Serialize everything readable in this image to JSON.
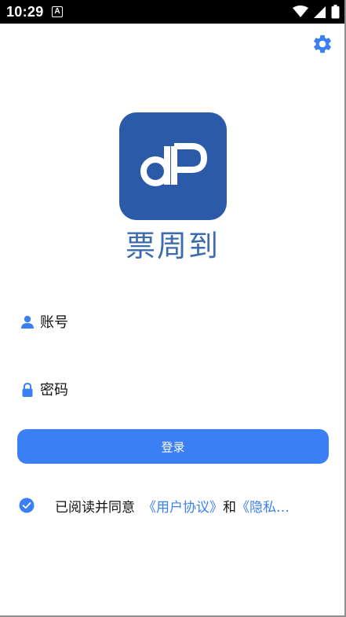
{
  "status_bar": {
    "time": "10:29",
    "notification_badge": "A"
  },
  "app": {
    "logo_title": "票周到"
  },
  "form": {
    "account_placeholder": "账号",
    "password_placeholder": "密码",
    "login_label": "登录"
  },
  "agreement": {
    "checked": true,
    "prefix": "已阅读并同意",
    "user_agreement_link": "《用户协议》",
    "conjunction": "和",
    "privacy_link": "《隐私…"
  },
  "colors": {
    "accent": "#3b7ff5",
    "logo_background": "#2a5aa8",
    "logo_text": "#3d6bb0"
  }
}
